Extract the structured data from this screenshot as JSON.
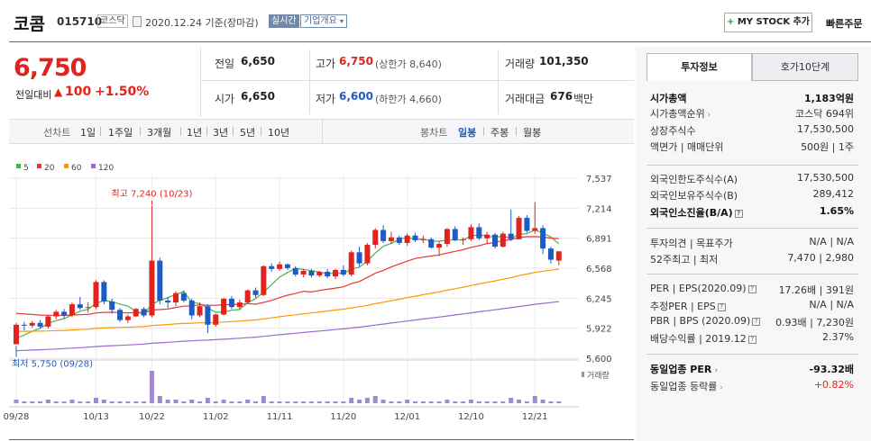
{
  "header": {
    "name": "코콤",
    "code": "015710",
    "market": "코스닥",
    "date": "2020.12.24 기준(장마감)",
    "realtime": "실시간",
    "overview": "기업개요",
    "mystock": "MY STOCK 추가",
    "quick_order": "빠른주문"
  },
  "price": {
    "current": "6,750",
    "change_label": "전일대비",
    "change": "100",
    "change_pct": "+1.50%"
  },
  "summary": {
    "prev_label": "전일",
    "prev": "6,650",
    "high_label": "고가",
    "high": "6,750",
    "upper_limit": "(상한가 8,640)",
    "volume_label": "거래량",
    "volume": "101,350",
    "open_label": "시가",
    "open": "6,650",
    "low_label": "저가",
    "low": "6,600",
    "lower_limit": "(하한가 4,660)",
    "amount_label": "거래대금",
    "amount": "676",
    "amount_unit": "백만"
  },
  "period": {
    "line_label": "선차트",
    "line_items": [
      "1일",
      "1주일",
      "3개월",
      "1년",
      "3년",
      "5년",
      "10년"
    ],
    "candle_label": "봉차트",
    "candle_items": [
      "일봉",
      "주봉",
      "월봉"
    ],
    "candle_selected": "일봉"
  },
  "chart_data": {
    "type": "candlestick",
    "legend": [
      "5",
      "20",
      "60",
      "120"
    ],
    "legend_colors": [
      "#4caf50",
      "#e53935",
      "#ff9800",
      "#9c6ad4"
    ],
    "y_ticks": [
      "7,537",
      "7,214",
      "6,891",
      "6,568",
      "6,245",
      "5,922",
      "5,600"
    ],
    "ylim": [
      5600,
      7537
    ],
    "x_ticks": [
      "09/28",
      "10/13",
      "10/22",
      "11/02",
      "11/11",
      "11/20",
      "12/01",
      "12/10",
      "12/21"
    ],
    "x_tick_index": [
      0,
      10,
      17,
      25,
      33,
      41,
      49,
      57,
      65
    ],
    "max_label": "최고 7,240 (10/23)",
    "min_label": "최저 5,750 (09/28)",
    "volume_label": "거래량",
    "candles": [
      [
        5750,
        5980,
        5750,
        5960
      ],
      [
        5960,
        5990,
        5900,
        5950
      ],
      [
        5950,
        6000,
        5930,
        5980
      ],
      [
        5980,
        6010,
        5920,
        5940
      ],
      [
        5940,
        6060,
        5920,
        6050
      ],
      [
        6050,
        6120,
        6020,
        6100
      ],
      [
        6100,
        6130,
        6030,
        6060
      ],
      [
        6060,
        6200,
        6040,
        6180
      ],
      [
        6180,
        6260,
        6120,
        6140
      ],
      [
        6140,
        6200,
        6090,
        6150
      ],
      [
        6150,
        6440,
        6130,
        6420
      ],
      [
        6420,
        6440,
        6180,
        6210
      ],
      [
        6210,
        6240,
        6080,
        6120
      ],
      [
        6120,
        6140,
        5990,
        6010
      ],
      [
        6010,
        6070,
        5980,
        6050
      ],
      [
        6050,
        6140,
        6040,
        6130
      ],
      [
        6130,
        6150,
        6040,
        6060
      ],
      [
        6060,
        7240,
        6040,
        6650
      ],
      [
        6650,
        6680,
        6180,
        6220
      ],
      [
        6220,
        6260,
        6140,
        6200
      ],
      [
        6200,
        6320,
        6160,
        6300
      ],
      [
        6300,
        6330,
        6200,
        6220
      ],
      [
        6220,
        6240,
        6020,
        6060
      ],
      [
        6060,
        6200,
        6040,
        6160
      ],
      [
        6160,
        6180,
        5870,
        5960
      ],
      [
        5960,
        6080,
        5940,
        6070
      ],
      [
        6070,
        6250,
        6060,
        6240
      ],
      [
        6240,
        6270,
        6130,
        6150
      ],
      [
        6150,
        6230,
        6120,
        6200
      ],
      [
        6200,
        6340,
        6190,
        6330
      ],
      [
        6330,
        6360,
        6250,
        6280
      ],
      [
        6280,
        6600,
        6270,
        6590
      ],
      [
        6590,
        6620,
        6530,
        6560
      ],
      [
        6560,
        6640,
        6540,
        6610
      ],
      [
        6610,
        6620,
        6550,
        6570
      ],
      [
        6570,
        6590,
        6480,
        6500
      ],
      [
        6500,
        6560,
        6470,
        6540
      ],
      [
        6540,
        6560,
        6470,
        6490
      ],
      [
        6490,
        6540,
        6470,
        6530
      ],
      [
        6530,
        6560,
        6460,
        6480
      ],
      [
        6480,
        6560,
        6450,
        6550
      ],
      [
        6550,
        6600,
        6480,
        6500
      ],
      [
        6500,
        6760,
        6480,
        6740
      ],
      [
        6740,
        6800,
        6590,
        6620
      ],
      [
        6620,
        6840,
        6600,
        6820
      ],
      [
        6820,
        7000,
        6780,
        6980
      ],
      [
        6980,
        7030,
        6840,
        6860
      ],
      [
        6860,
        6960,
        6830,
        6900
      ],
      [
        6900,
        6920,
        6820,
        6840
      ],
      [
        6840,
        6940,
        6810,
        6920
      ],
      [
        6920,
        6950,
        6850,
        6870
      ],
      [
        6870,
        6920,
        6840,
        6880
      ],
      [
        6880,
        6900,
        6780,
        6790
      ],
      [
        6790,
        6860,
        6700,
        6830
      ],
      [
        6830,
        7000,
        6800,
        6990
      ],
      [
        6990,
        7020,
        6860,
        6870
      ],
      [
        6870,
        6900,
        6820,
        6880
      ],
      [
        6880,
        7040,
        6860,
        7010
      ],
      [
        7010,
        7050,
        6870,
        6890
      ],
      [
        6890,
        6960,
        6830,
        6930
      ],
      [
        6930,
        6950,
        6780,
        6800
      ],
      [
        6800,
        6960,
        6790,
        6940
      ],
      [
        6940,
        7200,
        6860,
        6880
      ],
      [
        6880,
        7130,
        6880,
        7110
      ],
      [
        7110,
        7140,
        6950,
        6970
      ],
      [
        6970,
        7280,
        6940,
        7000
      ],
      [
        7000,
        7030,
        6720,
        6780
      ],
      [
        6780,
        6800,
        6620,
        6660
      ],
      [
        6650,
        6750,
        6600,
        6750
      ]
    ],
    "volumes": [
      2,
      1,
      1,
      1,
      2,
      1,
      1,
      2,
      1,
      1,
      3,
      2,
      1,
      1,
      1,
      1,
      1,
      18,
      4,
      2,
      2,
      1,
      2,
      1,
      3,
      1,
      2,
      1,
      1,
      2,
      1,
      4,
      1,
      1,
      1,
      1,
      1,
      1,
      1,
      1,
      1,
      1,
      3,
      2,
      3,
      4,
      2,
      1,
      1,
      2,
      1,
      1,
      1,
      1,
      2,
      1,
      1,
      2,
      1,
      1,
      1,
      1,
      3,
      2,
      1,
      4,
      2,
      1,
      1
    ]
  },
  "right_panel": {
    "tab_invest": "투자정보",
    "tab_quote": "호가10단계",
    "rows": [
      {
        "label": "시가총액",
        "value": "1,183억원",
        "bold": true
      },
      {
        "label": "시가총액순위",
        "value": "코스닥 694위",
        "chev": true
      },
      {
        "label": "상장주식수",
        "value": "17,530,500"
      },
      {
        "label": "액면가 | 매매단위",
        "value": "500원 | 1주"
      },
      {
        "label": "외국인한도주식수(A)",
        "value": "17,530,500"
      },
      {
        "label": "외국인보유주식수(B)",
        "value": "289,412"
      },
      {
        "label": "외국인소진율(B/A)",
        "value": "1.65%",
        "bold": true,
        "q": true
      },
      {
        "label": "투자의견 | 목표주가",
        "value": "N/A | N/A"
      },
      {
        "label": "52주최고 | 최저",
        "value": "7,470 | 2,980"
      },
      {
        "label": "PER | EPS(2020.09)",
        "value": "17.26배 | 391원",
        "q": true
      },
      {
        "label": "추정PER | EPS",
        "value": "N/A | N/A",
        "q": true
      },
      {
        "label": "PBR | BPS (2020.09)",
        "value": "0.93배 | 7,230원",
        "q": true
      },
      {
        "label": "배당수익률 | 2019.12",
        "value": "2.37%",
        "q": true
      },
      {
        "label": "동일업종 PER",
        "value": "-93.32배",
        "bold": true,
        "chev": true
      },
      {
        "label": "동일업종 등락률",
        "value": "+0.82%",
        "red": true,
        "chev": true
      }
    ]
  }
}
